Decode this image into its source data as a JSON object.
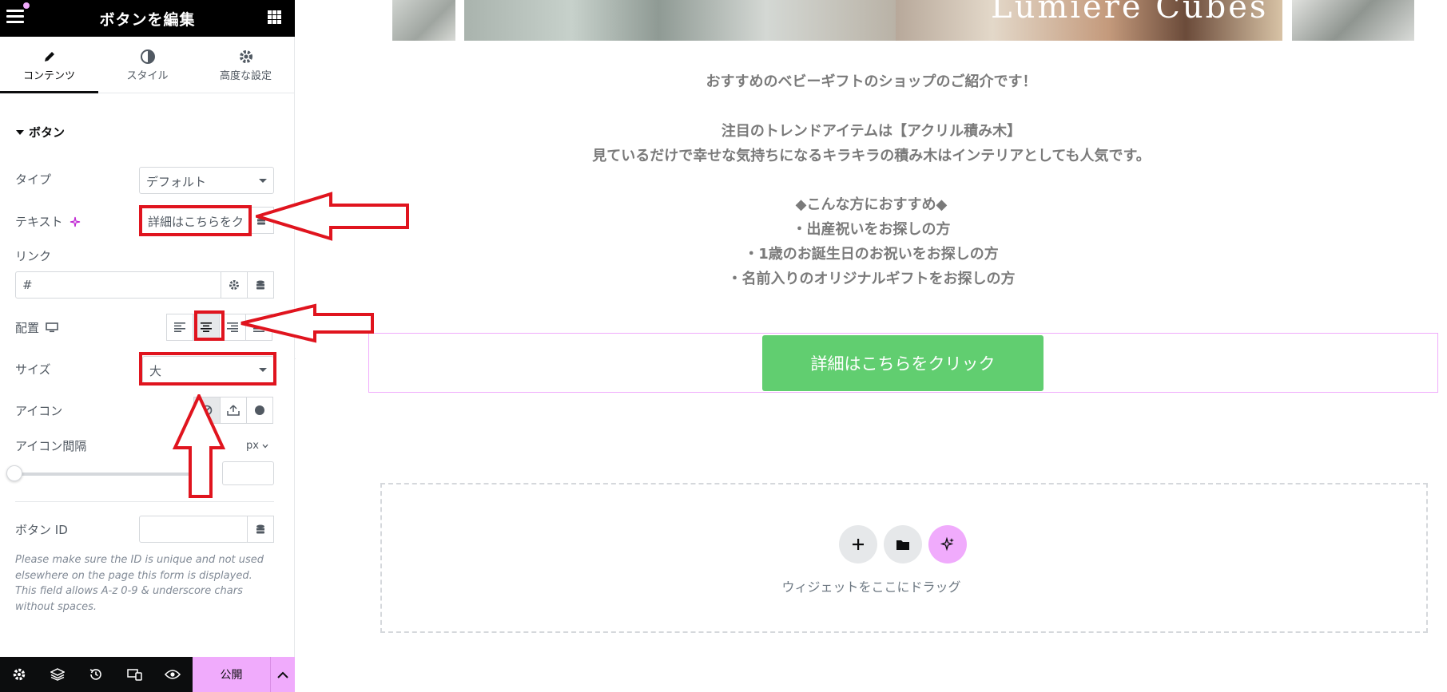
{
  "sidebar": {
    "title": "ボタンを編集",
    "tabs": [
      {
        "label": "コンテンツ",
        "icon": "pencil-icon"
      },
      {
        "label": "スタイル",
        "icon": "contrast-icon"
      },
      {
        "label": "高度な設定",
        "icon": "gear-icon"
      }
    ],
    "section": "ボタン",
    "type_label": "タイプ",
    "type_value": "デフォルト",
    "text_label": "テキスト",
    "text_value": "詳細はこちらをク",
    "link_label": "リンク",
    "link_value": "#",
    "align_label": "配置",
    "align_selected": "center",
    "size_label": "サイズ",
    "size_value": "大",
    "icon_label": "アイコン",
    "icon_spacing_label": "アイコン間隔",
    "icon_spacing_unit": "px",
    "button_id_label": "ボタン ID",
    "button_id_value": "",
    "help_text": "Please make sure the ID is unique and not used elsewhere on the page this form is displayed. This field allows A-z 0-9 & underscore chars without spaces."
  },
  "footer": {
    "publish_label": "公開"
  },
  "canvas": {
    "hero_text": "Lumiere Cubes",
    "intro": "おすすめのベビーギフトのショップのご紹介です！",
    "trend_line1": "注目のトレンドアイテムは【アクリル積み木】",
    "trend_line2": "見ているだけで幸せな気持ちになるキラキラの積み木はインテリアとしても人気です。",
    "recommend_head": "◆こんな方におすすめ◆",
    "recommend_items": [
      "・出産祝いをお探しの方",
      "・1歳のお誕生日のお祝いをお探しの方",
      "・名前入りのオリジナルギフトをお探しの方"
    ],
    "cta_label": "詳細はこちらをクリック",
    "drop_text": "ウィジェットをここにドラッグ"
  },
  "colors": {
    "accent": "#f0abfc",
    "cta": "#61ce70",
    "annotation": "#e0141e"
  }
}
